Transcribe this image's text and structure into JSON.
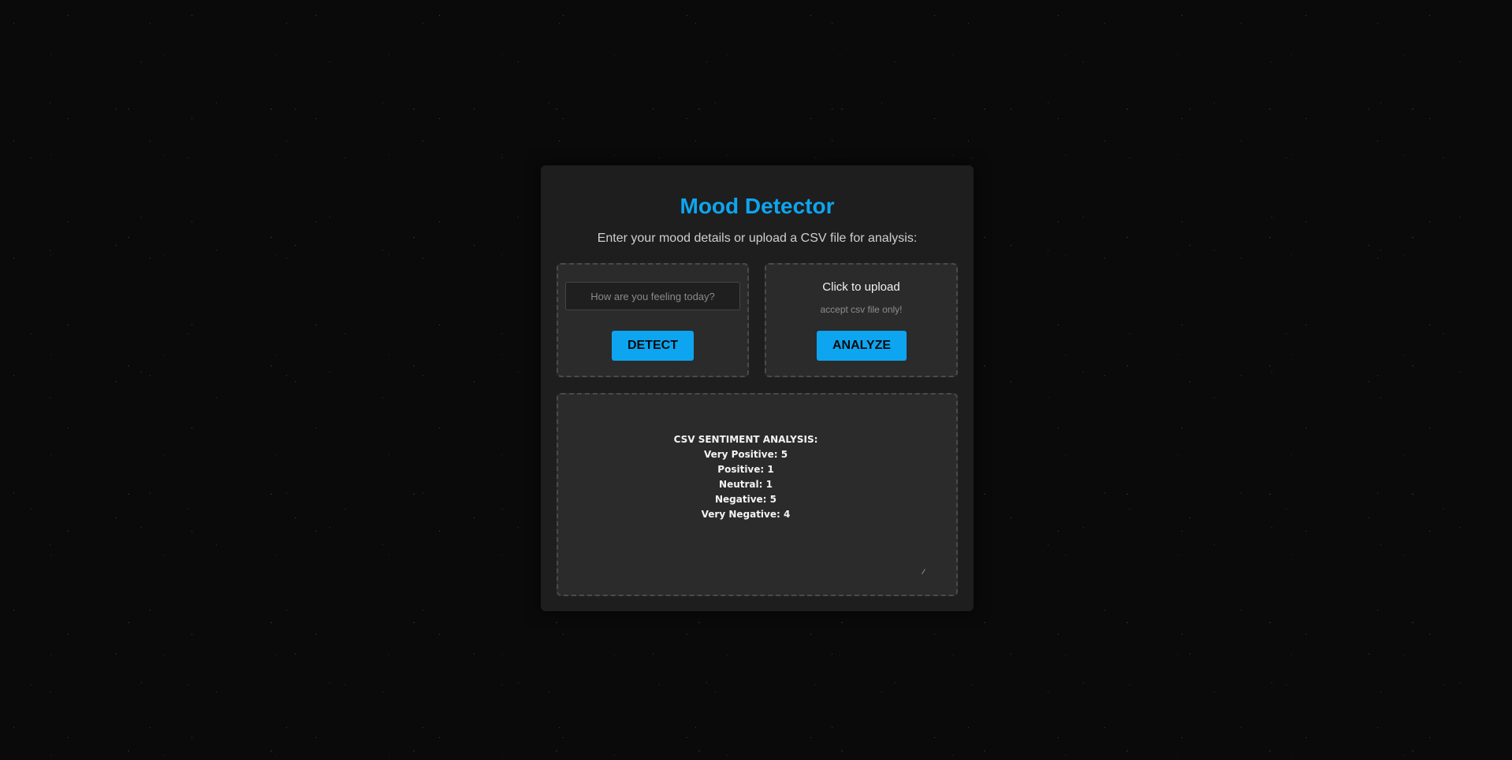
{
  "header": {
    "title": "Mood Detector",
    "subtitle": "Enter your mood details or upload a CSV file for analysis:"
  },
  "text_panel": {
    "input_placeholder": "How are you feeling today?",
    "input_value": "",
    "detect_label": "DETECT"
  },
  "upload_panel": {
    "upload_label": "Click to upload",
    "upload_hint": "accept csv file only!",
    "analyze_label": "ANALYZE"
  },
  "result": {
    "heading": "CSV SENTIMENT ANALYSIS:",
    "lines": [
      "Very Positive: 5",
      "Positive: 1",
      "Neutral: 1",
      "Negative: 5",
      "Very Negative: 4"
    ]
  },
  "colors": {
    "accent": "#0ea5f0",
    "background": "#0a0a0a",
    "card": "#1e1e1e",
    "panel": "#2b2b2b"
  }
}
